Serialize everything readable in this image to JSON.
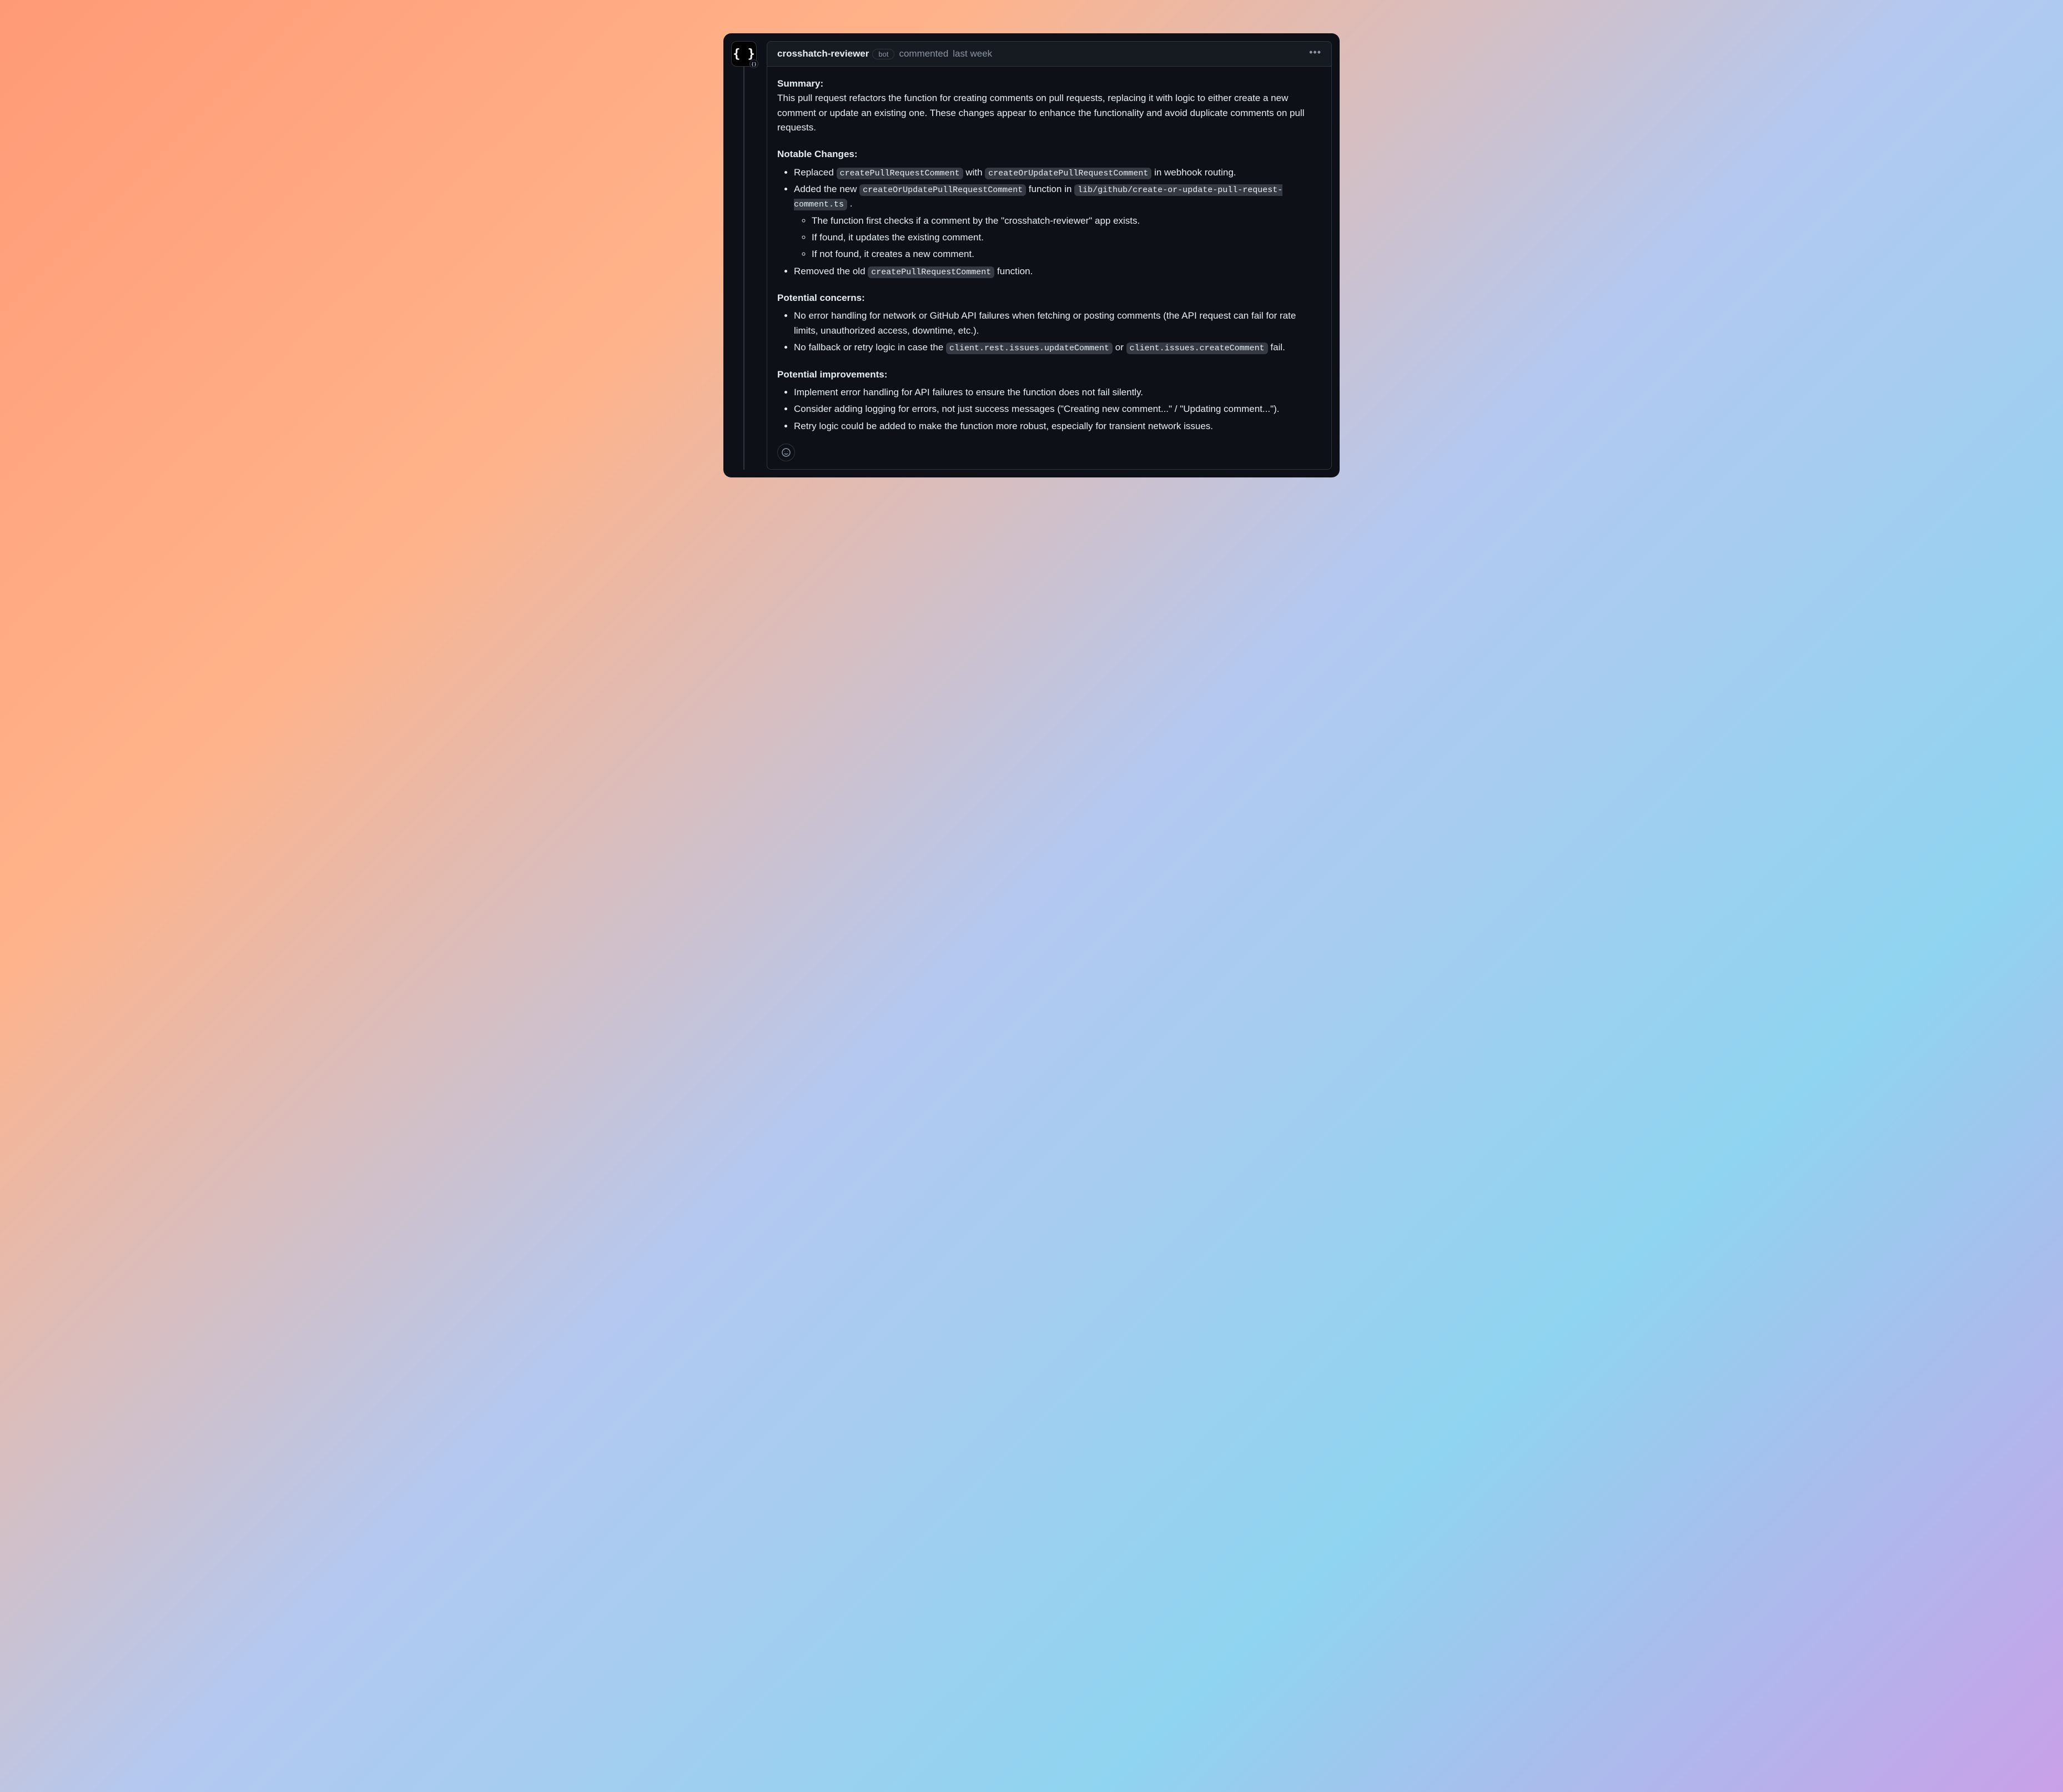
{
  "header": {
    "author": "crosshatch-reviewer",
    "bot_badge": "bot",
    "action_text": "commented",
    "timestamp": "last week"
  },
  "body": {
    "summary": {
      "heading": "Summary",
      "text": "This pull request refactors the function for creating comments on pull requests, replacing it with logic to either create a new comment or update an existing one. These changes appear to enhance the functionality and avoid duplicate comments on pull requests."
    },
    "notable_changes": {
      "heading": "Notable Changes",
      "items": [
        {
          "pre": "Replaced ",
          "code1": "createPullRequestComment",
          "mid": " with ",
          "code2": "createOrUpdatePullRequestComment",
          "post": " in webhook routing."
        },
        {
          "pre": "Added the new ",
          "code1": "createOrUpdatePullRequestComment",
          "mid": " function in ",
          "code2": "lib/github/create-or-update-pull-request-comment.ts",
          "post": " .",
          "sub": [
            "The function first checks if a comment by the \"crosshatch-reviewer\" app exists.",
            "If found, it updates the existing comment.",
            "If not found, it creates a new comment."
          ]
        },
        {
          "pre": "Removed the old ",
          "code1": "createPullRequestComment",
          "post": " function."
        }
      ]
    },
    "concerns": {
      "heading": "Potential concerns",
      "items": [
        {
          "text": "No error handling for network or GitHub API failures when fetching or posting comments (the API request can fail for rate limits, unauthorized access, downtime, etc.)."
        },
        {
          "pre": "No fallback or retry logic in case the ",
          "code1": "client.rest.issues.updateComment",
          "mid": " or ",
          "code2": "client.issues.createComment",
          "post": " fail."
        }
      ]
    },
    "improvements": {
      "heading": "Potential improvements",
      "items": [
        "Implement error handling for API failures to ensure the function does not fail silently.",
        "Consider adding logging for errors, not just success messages (\"Creating new comment...\" / \"Updating comment...\").",
        "Retry logic could be added to make the function more robust, especially for transient network issues."
      ]
    }
  }
}
